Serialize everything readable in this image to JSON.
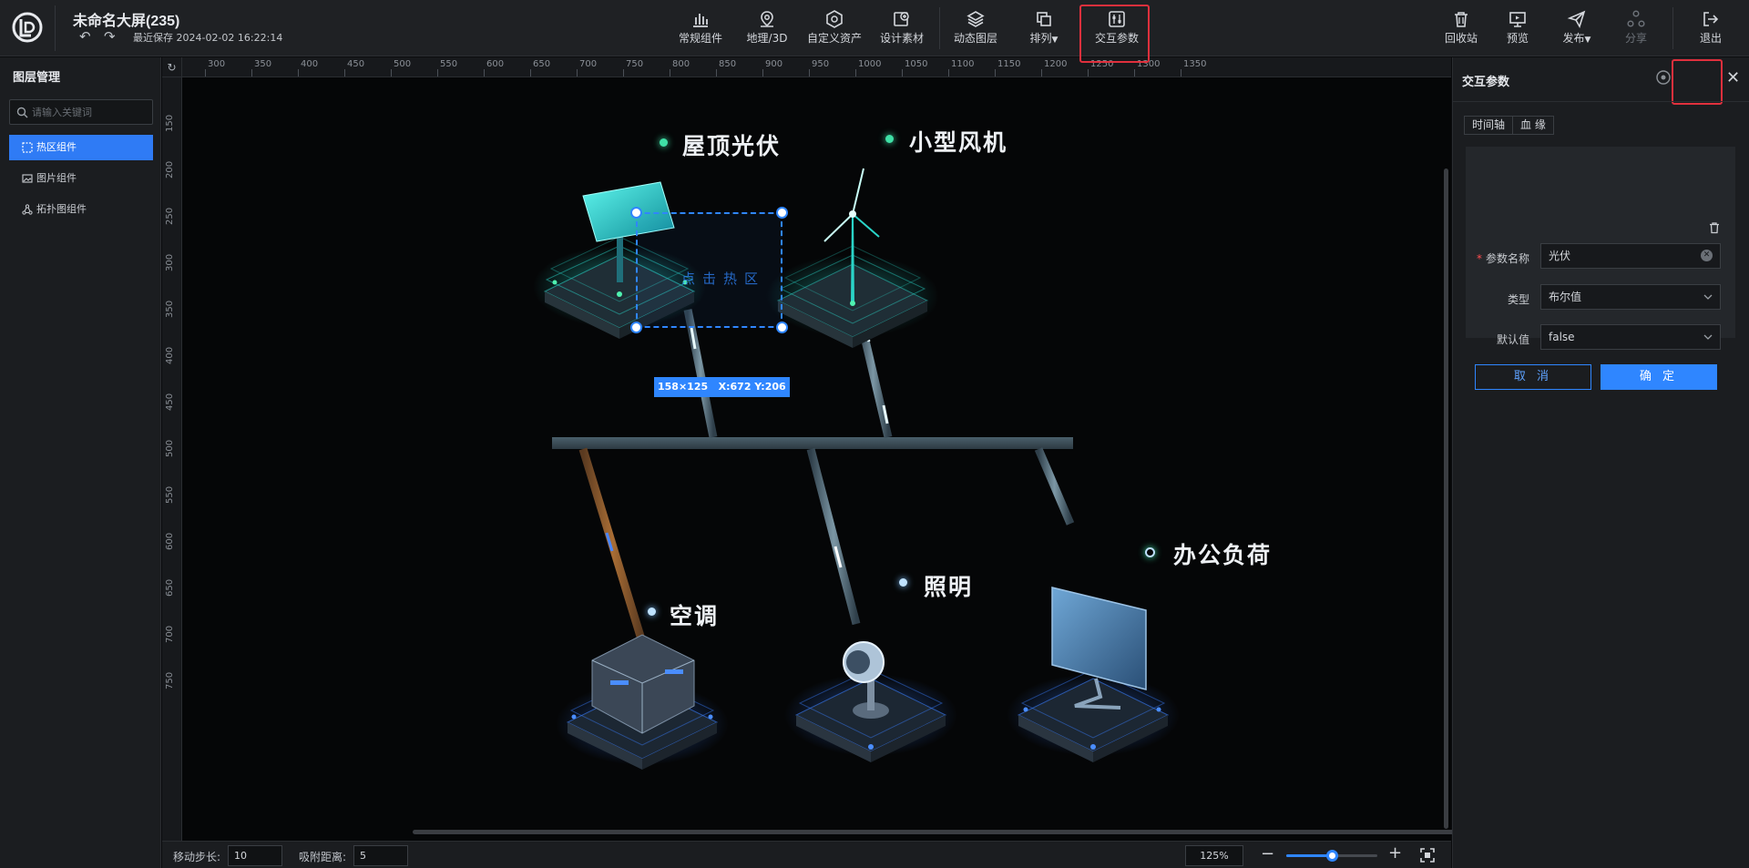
{
  "app": {
    "doc_title": "未命名大屏(235)",
    "last_save": "最近保存 2024-02-02 16:22:14"
  },
  "toolbar": {
    "center": [
      {
        "label": "常规组件",
        "icon": "bar-chart-icon"
      },
      {
        "label": "地理/3D",
        "icon": "map-pin-icon"
      },
      {
        "label": "自定义资产",
        "icon": "hexagon-icon"
      },
      {
        "label": "设计素材",
        "icon": "image-plus-icon"
      },
      {
        "label": "动态图层",
        "icon": "layers-icon"
      },
      {
        "label": "排列",
        "icon": "arrange-icon"
      },
      {
        "label": "交互参数",
        "icon": "sliders-icon"
      }
    ],
    "right": [
      {
        "label": "回收站",
        "icon": "trash-icon"
      },
      {
        "label": "预览",
        "icon": "monitor-icon"
      },
      {
        "label": "发布",
        "icon": "send-icon"
      },
      {
        "label": "分享",
        "icon": "share-icon"
      },
      {
        "label": "退出",
        "icon": "exit-icon"
      }
    ],
    "highlight_color": "#e0303d"
  },
  "left_panel": {
    "title": "图层管理",
    "search_placeholder": "请输入关键词",
    "layers": [
      {
        "label": "热区组件",
        "active": true
      },
      {
        "label": "图片组件",
        "active": false
      },
      {
        "label": "拓扑图组件",
        "active": false
      }
    ]
  },
  "rulers": {
    "top_ticks": [
      "300",
      "350",
      "400",
      "450",
      "500",
      "550",
      "600",
      "650",
      "700",
      "750",
      "800",
      "850",
      "900",
      "950",
      "1000",
      "1050",
      "1100",
      "1150",
      "1200",
      "1250",
      "1300",
      "1350"
    ],
    "left_ticks": [
      "150",
      "200",
      "250",
      "300",
      "350",
      "400",
      "450",
      "500",
      "550",
      "600",
      "650",
      "700",
      "750"
    ]
  },
  "canvas": {
    "labels": {
      "pv": "屋顶光伏",
      "wind": "小型风机",
      "ac": "空调",
      "lighting": "照明",
      "office": "办公负荷"
    },
    "hotzone_text": "点击热区",
    "selection_info": "158×125   X:672 Y:206",
    "accent": "#2f86ff"
  },
  "bottom_bar": {
    "step_label": "移动步长:",
    "step_value": "10",
    "snap_label": "吸附距离:",
    "snap_value": "5",
    "zoom": "125%",
    "zoom_level": 0.5
  },
  "right_panel": {
    "title": "交互参数",
    "tabs": [
      "时间轴",
      "血 缘"
    ],
    "form": {
      "name_label": "参数名称",
      "name_value": "光伏",
      "type_label": "类型",
      "type_value": "布尔值",
      "default_label": "默认值",
      "default_value": "false"
    },
    "cancel": "取 消",
    "ok": "确 定"
  }
}
